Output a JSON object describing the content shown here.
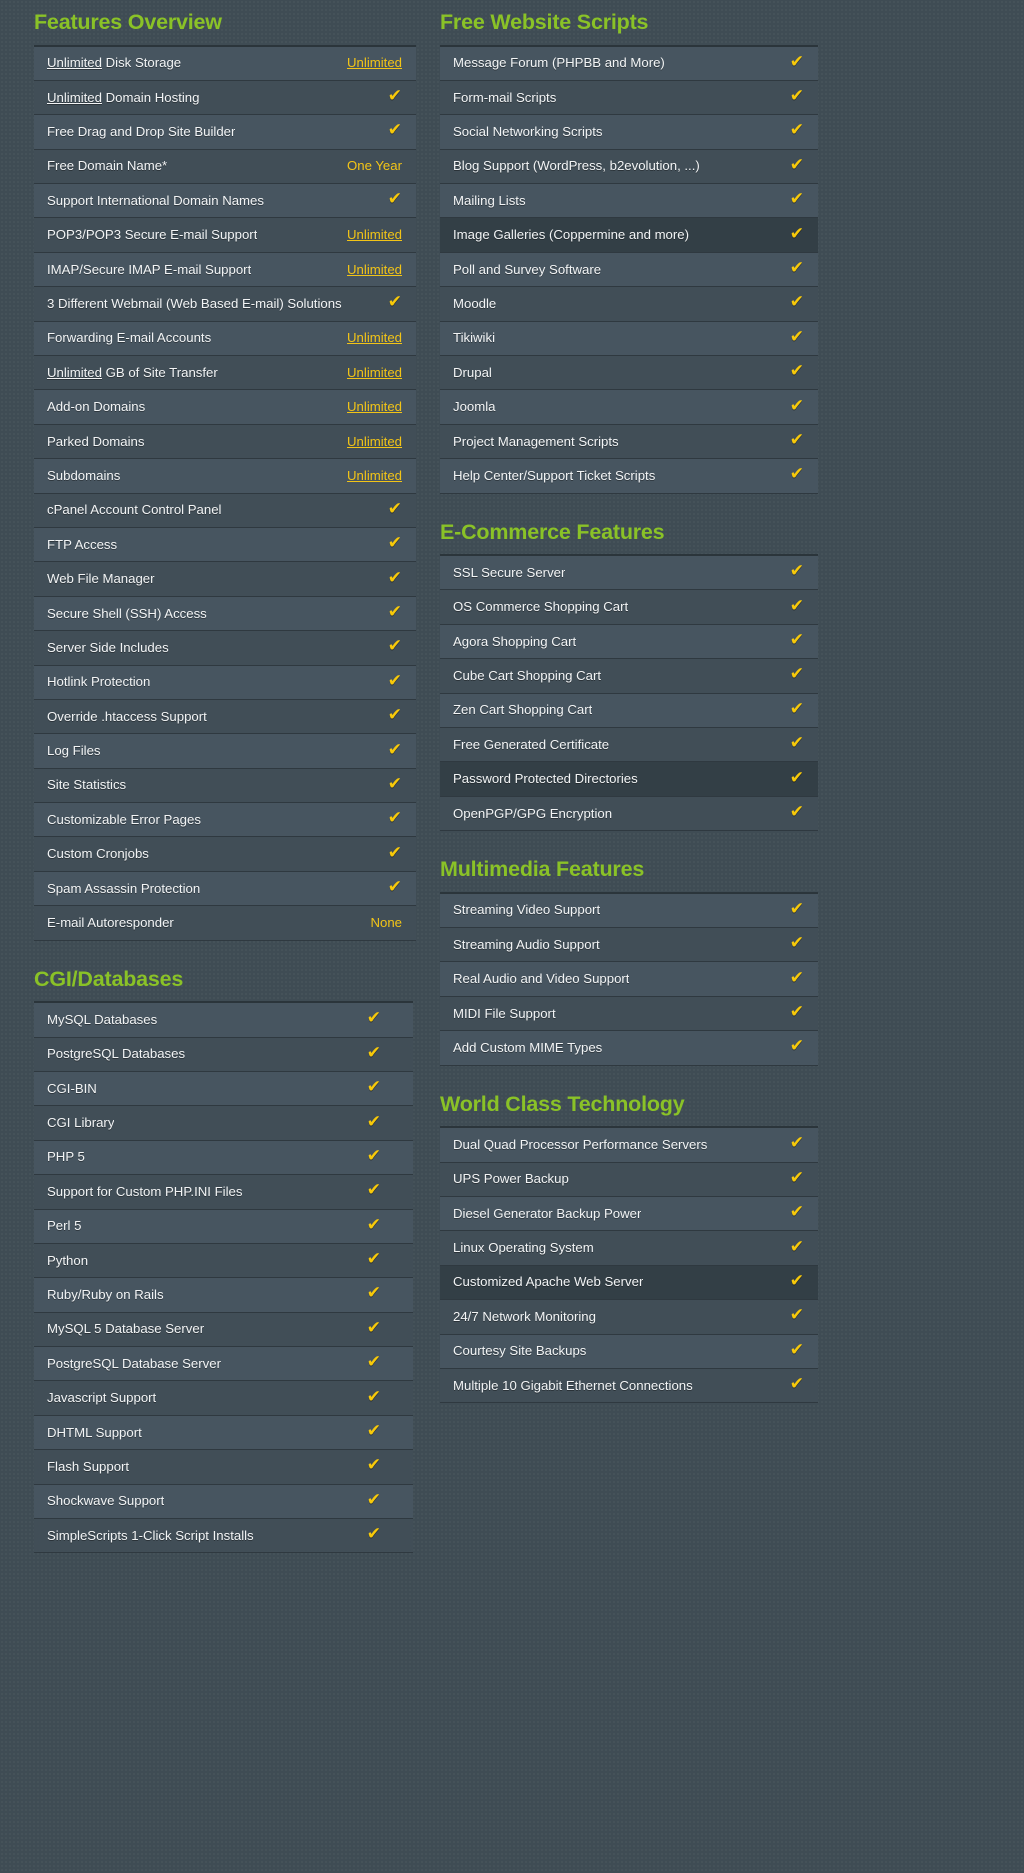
{
  "theme": {
    "background": "#3f4c54",
    "heading_green": "#8ac227",
    "accent_yellow": "#f2c417",
    "check_yellow": "#f7c90a",
    "row_base": "#475560",
    "row_alt": "#414e57",
    "row_highlight": "#333f46",
    "text": "#f2f4f5"
  },
  "icons": {
    "check": "✔",
    "check_name": "checkmark-icon"
  },
  "left_column": {
    "sections": [
      {
        "title": "Features Overview",
        "rows": [
          {
            "label_pre": "Unlimited",
            "label": " Disk Storage",
            "value_type": "link",
            "value": "Unlimited",
            "highlight": false
          },
          {
            "label_pre": "Unlimited",
            "label": " Domain Hosting",
            "value_type": "check",
            "value": "✔",
            "highlight": false
          },
          {
            "label_pre": "",
            "label": "Free Drag and Drop Site Builder",
            "value_type": "check",
            "value": "✔",
            "highlight": false
          },
          {
            "label_pre": "",
            "label": "Free Domain Name*",
            "value_type": "text",
            "value": "One Year",
            "highlight": false
          },
          {
            "label_pre": "",
            "label": "Support International Domain Names",
            "value_type": "check",
            "value": "✔",
            "highlight": false
          },
          {
            "label_pre": "",
            "label": "POP3/POP3 Secure E-mail Support",
            "value_type": "link",
            "value": "Unlimited",
            "highlight": false
          },
          {
            "label_pre": "",
            "label": "IMAP/Secure IMAP E-mail Support",
            "value_type": "link",
            "value": "Unlimited",
            "highlight": false
          },
          {
            "label_pre": "",
            "label": "3 Different Webmail (Web Based E-mail) Solutions",
            "value_type": "check",
            "value": "✔",
            "highlight": false
          },
          {
            "label_pre": "",
            "label": "Forwarding E-mail Accounts",
            "value_type": "link",
            "value": "Unlimited",
            "highlight": false
          },
          {
            "label_pre": "Unlimited",
            "label": " GB of Site Transfer",
            "value_type": "link",
            "value": "Unlimited",
            "highlight": false
          },
          {
            "label_pre": "",
            "label": "Add-on Domains",
            "value_type": "link",
            "value": "Unlimited",
            "highlight": false
          },
          {
            "label_pre": "",
            "label": "Parked Domains",
            "value_type": "link",
            "value": "Unlimited",
            "highlight": false
          },
          {
            "label_pre": "",
            "label": "Subdomains",
            "value_type": "link",
            "value": "Unlimited",
            "highlight": false
          },
          {
            "label_pre": "",
            "label": "cPanel Account Control Panel",
            "value_type": "check",
            "value": "✔",
            "highlight": false
          },
          {
            "label_pre": "",
            "label": "FTP Access",
            "value_type": "check",
            "value": "✔",
            "highlight": false
          },
          {
            "label_pre": "",
            "label": "Web File Manager",
            "value_type": "check",
            "value": "✔",
            "highlight": false
          },
          {
            "label_pre": "",
            "label": "Secure Shell (SSH) Access",
            "value_type": "check",
            "value": "✔",
            "highlight": false
          },
          {
            "label_pre": "",
            "label": "Server Side Includes",
            "value_type": "check",
            "value": "✔",
            "highlight": false
          },
          {
            "label_pre": "",
            "label": "Hotlink Protection",
            "value_type": "check",
            "value": "✔",
            "highlight": false
          },
          {
            "label_pre": "",
            "label": "Override .htaccess Support",
            "value_type": "check",
            "value": "✔",
            "highlight": false
          },
          {
            "label_pre": "",
            "label": "Log Files",
            "value_type": "check",
            "value": "✔",
            "highlight": false
          },
          {
            "label_pre": "",
            "label": "Site Statistics",
            "value_type": "check",
            "value": "✔",
            "highlight": false
          },
          {
            "label_pre": "",
            "label": "Customizable Error Pages",
            "value_type": "check",
            "value": "✔",
            "highlight": false
          },
          {
            "label_pre": "",
            "label": "Custom Cronjobs",
            "value_type": "check",
            "value": "✔",
            "highlight": false
          },
          {
            "label_pre": "",
            "label": "Spam Assassin Protection",
            "value_type": "check",
            "value": "✔",
            "highlight": false
          },
          {
            "label_pre": "",
            "label": "E-mail Autoresponder",
            "value_type": "text",
            "value": "None",
            "highlight": false
          }
        ]
      },
      {
        "title": "CGI/Databases",
        "narrow": true,
        "rows": [
          {
            "label_pre": "",
            "label": "MySQL Databases",
            "value_type": "check",
            "value": "✔",
            "highlight": false
          },
          {
            "label_pre": "",
            "label": "PostgreSQL Databases",
            "value_type": "check",
            "value": "✔",
            "highlight": false
          },
          {
            "label_pre": "",
            "label": "CGI-BIN",
            "value_type": "check",
            "value": "✔",
            "highlight": false
          },
          {
            "label_pre": "",
            "label": "CGI Library",
            "value_type": "check",
            "value": "✔",
            "highlight": false
          },
          {
            "label_pre": "",
            "label": "PHP 5",
            "value_type": "check",
            "value": "✔",
            "highlight": false
          },
          {
            "label_pre": "",
            "label": "Support for Custom PHP.INI Files",
            "value_type": "check",
            "value": "✔",
            "highlight": false
          },
          {
            "label_pre": "",
            "label": "Perl 5",
            "value_type": "check",
            "value": "✔",
            "highlight": false
          },
          {
            "label_pre": "",
            "label": "Python",
            "value_type": "check",
            "value": "✔",
            "highlight": false
          },
          {
            "label_pre": "",
            "label": "Ruby/Ruby on Rails",
            "value_type": "check",
            "value": "✔",
            "highlight": false
          },
          {
            "label_pre": "",
            "label": "MySQL 5 Database Server",
            "value_type": "check",
            "value": "✔",
            "highlight": false
          },
          {
            "label_pre": "",
            "label": "PostgreSQL Database Server",
            "value_type": "check",
            "value": "✔",
            "highlight": false
          },
          {
            "label_pre": "",
            "label": "Javascript Support",
            "value_type": "check",
            "value": "✔",
            "highlight": false
          },
          {
            "label_pre": "",
            "label": "DHTML Support",
            "value_type": "check",
            "value": "✔",
            "highlight": false
          },
          {
            "label_pre": "",
            "label": "Flash Support",
            "value_type": "check",
            "value": "✔",
            "highlight": false
          },
          {
            "label_pre": "",
            "label": "Shockwave Support",
            "value_type": "check",
            "value": "✔",
            "highlight": false
          },
          {
            "label_pre": "",
            "label": "SimpleScripts 1-Click Script Installs",
            "value_type": "check",
            "value": "✔",
            "highlight": false
          }
        ]
      }
    ]
  },
  "right_column": {
    "sections": [
      {
        "title": "Free Website Scripts",
        "rows": [
          {
            "label_pre": "",
            "label": "Message Forum (PHPBB and More)",
            "value_type": "check",
            "value": "✔",
            "highlight": false
          },
          {
            "label_pre": "",
            "label": "Form-mail Scripts",
            "value_type": "check",
            "value": "✔",
            "highlight": false
          },
          {
            "label_pre": "",
            "label": "Social Networking Scripts",
            "value_type": "check",
            "value": "✔",
            "highlight": false
          },
          {
            "label_pre": "",
            "label": "Blog Support (WordPress, b2evolution, ...)",
            "value_type": "check",
            "value": "✔",
            "highlight": false
          },
          {
            "label_pre": "",
            "label": "Mailing Lists",
            "value_type": "check",
            "value": "✔",
            "highlight": false
          },
          {
            "label_pre": "",
            "label": "Image Galleries (Coppermine and more)",
            "value_type": "check",
            "value": "✔",
            "highlight": true
          },
          {
            "label_pre": "",
            "label": "Poll and Survey Software",
            "value_type": "check",
            "value": "✔",
            "highlight": false
          },
          {
            "label_pre": "",
            "label": "Moodle",
            "value_type": "check",
            "value": "✔",
            "highlight": false
          },
          {
            "label_pre": "",
            "label": "Tikiwiki",
            "value_type": "check",
            "value": "✔",
            "highlight": false
          },
          {
            "label_pre": "",
            "label": "Drupal",
            "value_type": "check",
            "value": "✔",
            "highlight": false
          },
          {
            "label_pre": "",
            "label": "Joomla",
            "value_type": "check",
            "value": "✔",
            "highlight": false
          },
          {
            "label_pre": "",
            "label": "Project Management Scripts",
            "value_type": "check",
            "value": "✔",
            "highlight": false
          },
          {
            "label_pre": "",
            "label": "Help Center/Support Ticket Scripts",
            "value_type": "check",
            "value": "✔",
            "highlight": false
          }
        ]
      },
      {
        "title": "E-Commerce Features",
        "rows": [
          {
            "label_pre": "",
            "label": "SSL Secure Server",
            "value_type": "check",
            "value": "✔",
            "highlight": false
          },
          {
            "label_pre": "",
            "label": "OS Commerce Shopping Cart",
            "value_type": "check",
            "value": "✔",
            "highlight": false
          },
          {
            "label_pre": "",
            "label": "Agora Shopping Cart",
            "value_type": "check",
            "value": "✔",
            "highlight": false
          },
          {
            "label_pre": "",
            "label": "Cube Cart Shopping Cart",
            "value_type": "check",
            "value": "✔",
            "highlight": false
          },
          {
            "label_pre": "",
            "label": "Zen Cart Shopping Cart",
            "value_type": "check",
            "value": "✔",
            "highlight": false
          },
          {
            "label_pre": "",
            "label": "Free Generated Certificate",
            "value_type": "check",
            "value": "✔",
            "highlight": false
          },
          {
            "label_pre": "",
            "label": "Password Protected Directories",
            "value_type": "check",
            "value": "✔",
            "highlight": true
          },
          {
            "label_pre": "",
            "label": "OpenPGP/GPG Encryption",
            "value_type": "check",
            "value": "✔",
            "highlight": false
          }
        ]
      },
      {
        "title": "Multimedia Features",
        "rows": [
          {
            "label_pre": "",
            "label": "Streaming Video Support",
            "value_type": "check",
            "value": "✔",
            "highlight": false
          },
          {
            "label_pre": "",
            "label": "Streaming Audio Support",
            "value_type": "check",
            "value": "✔",
            "highlight": false
          },
          {
            "label_pre": "",
            "label": "Real Audio and Video Support",
            "value_type": "check",
            "value": "✔",
            "highlight": false
          },
          {
            "label_pre": "",
            "label": "MIDI File Support",
            "value_type": "check",
            "value": "✔",
            "highlight": false
          },
          {
            "label_pre": "",
            "label": "Add Custom MIME Types",
            "value_type": "check",
            "value": "✔",
            "highlight": false
          }
        ]
      },
      {
        "title": "World Class Technology",
        "rows": [
          {
            "label_pre": "",
            "label": "Dual Quad Processor Performance Servers",
            "value_type": "check",
            "value": "✔",
            "highlight": false
          },
          {
            "label_pre": "",
            "label": "UPS Power Backup",
            "value_type": "check",
            "value": "✔",
            "highlight": false
          },
          {
            "label_pre": "",
            "label": "Diesel Generator Backup Power",
            "value_type": "check",
            "value": "✔",
            "highlight": false
          },
          {
            "label_pre": "",
            "label": "Linux Operating System",
            "value_type": "check",
            "value": "✔",
            "highlight": false
          },
          {
            "label_pre": "",
            "label": "Customized Apache Web Server",
            "value_type": "check",
            "value": "✔",
            "highlight": true
          },
          {
            "label_pre": "",
            "label": "24/7 Network Monitoring",
            "value_type": "check",
            "value": "✔",
            "highlight": false
          },
          {
            "label_pre": "",
            "label": "Courtesy Site Backups",
            "value_type": "check",
            "value": "✔",
            "highlight": false
          },
          {
            "label_pre": "",
            "label": "Multiple 10 Gigabit Ethernet Connections",
            "value_type": "check",
            "value": "✔",
            "highlight": false
          }
        ]
      }
    ]
  }
}
